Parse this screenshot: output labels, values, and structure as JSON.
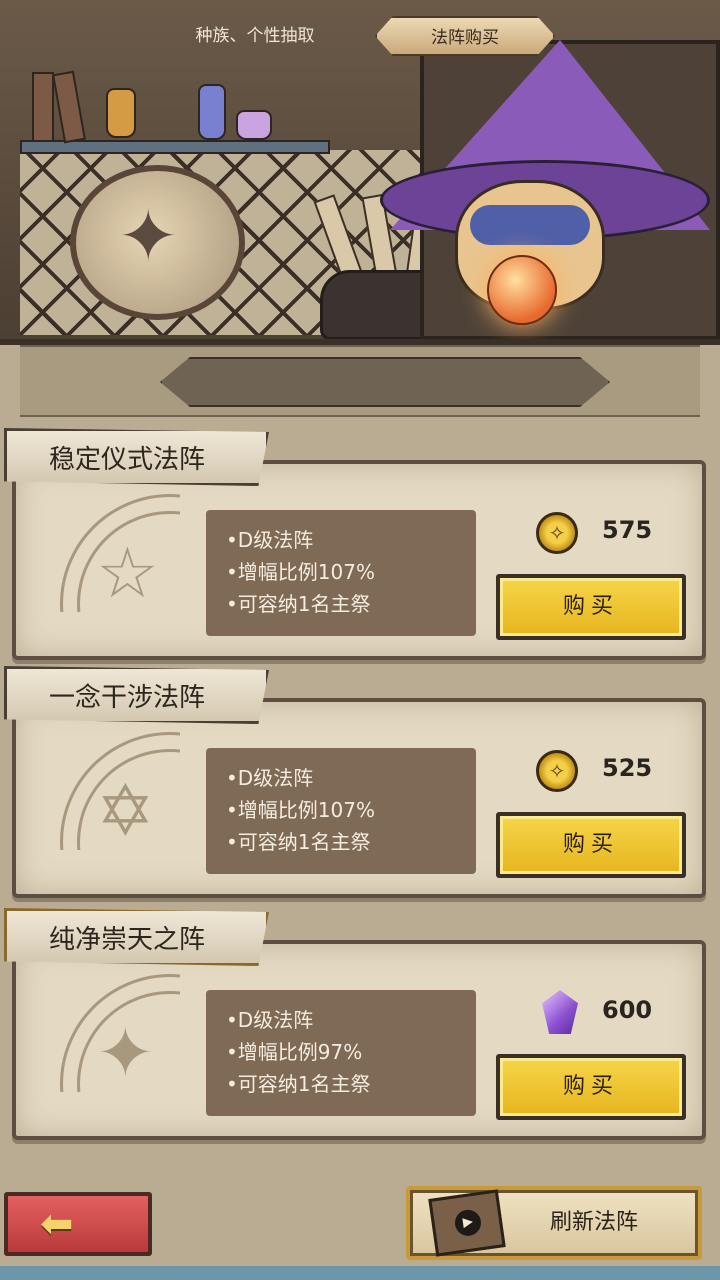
{
  "tabs": {
    "race_trait": "种族、个性抽取",
    "array_shop": "法阵购买"
  },
  "cards": [
    {
      "title": "稳定仪式法阵",
      "lines": [
        "•D级法阵",
        "•增幅比例107%",
        "•可容纳1名主祭"
      ],
      "currency": "coin",
      "price": "575",
      "buy_label": "购买"
    },
    {
      "title": "一念干涉法阵",
      "lines": [
        "•D级法阵",
        "•增幅比例107%",
        "•可容纳1名主祭"
      ],
      "currency": "coin",
      "price": "525",
      "buy_label": "购买"
    },
    {
      "title": "纯净崇天之阵",
      "lines": [
        "•D级法阵",
        "•增幅比例97%",
        "•可容纳1名主祭"
      ],
      "currency": "gem",
      "price": "600",
      "buy_label": "购买"
    }
  ],
  "footer": {
    "refresh_label": "刷新法阵"
  },
  "colors": {
    "buy_button": "#f2c834",
    "back_button": "#d44a4a",
    "info_box": "#7f6a55",
    "card_bg": "#e4dac3"
  }
}
